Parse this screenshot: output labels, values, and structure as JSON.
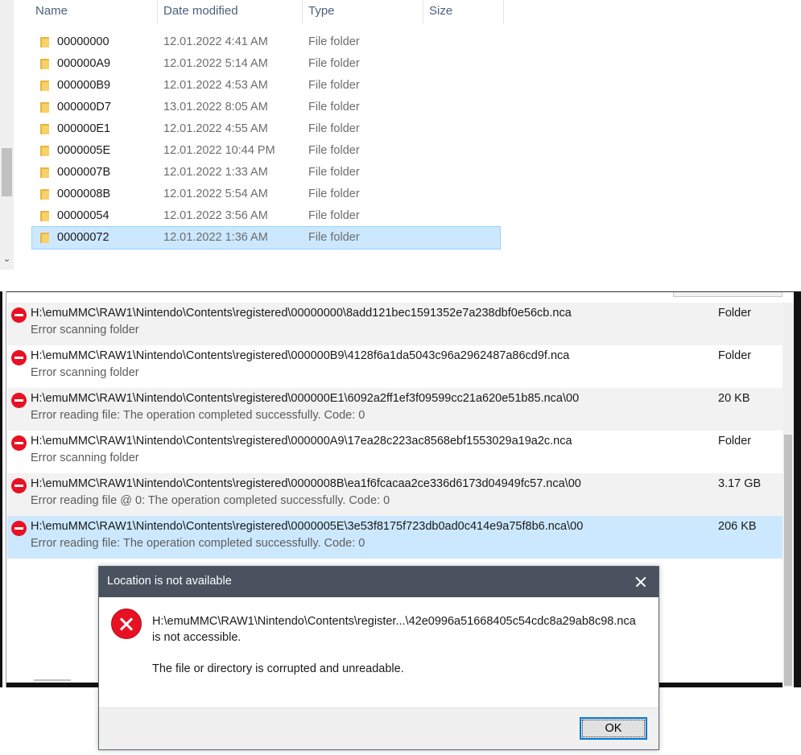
{
  "explorer": {
    "columns": {
      "name": "Name",
      "date": "Date modified",
      "type": "Type",
      "size": "Size"
    },
    "rows": [
      {
        "name": "00000000",
        "date": "12.01.2022 4:41 AM",
        "type": "File folder"
      },
      {
        "name": "000000A9",
        "date": "12.01.2022 5:14 AM",
        "type": "File folder"
      },
      {
        "name": "000000B9",
        "date": "12.01.2022 4:53 AM",
        "type": "File folder"
      },
      {
        "name": "000000D7",
        "date": "13.01.2022 8:05 AM",
        "type": "File folder"
      },
      {
        "name": "000000E1",
        "date": "12.01.2022 4:55 AM",
        "type": "File folder"
      },
      {
        "name": "0000005E",
        "date": "12.01.2022 10:44 PM",
        "type": "File folder"
      },
      {
        "name": "0000007B",
        "date": "12.01.2022 1:33 AM",
        "type": "File folder"
      },
      {
        "name": "0000008B",
        "date": "12.01.2022 5:54 AM",
        "type": "File folder"
      },
      {
        "name": "00000054",
        "date": "12.01.2022 3:56 AM",
        "type": "File folder"
      },
      {
        "name": "00000072",
        "date": "12.01.2022 1:36 AM",
        "type": "File folder"
      }
    ],
    "selected_row": "00000072"
  },
  "errors": {
    "items": [
      {
        "path": "H:\\emuMMC\\RAW1\\Nintendo\\Contents\\registered\\00000000\\8add121bec1591352e7a238dbf0e56cb.nca",
        "message": "Error scanning folder",
        "size": "Folder"
      },
      {
        "path": "H:\\emuMMC\\RAW1\\Nintendo\\Contents\\registered\\000000B9\\4128f6a1da5043c96a2962487a86cd9f.nca",
        "message": "Error scanning folder",
        "size": "Folder"
      },
      {
        "path": "H:\\emuMMC\\RAW1\\Nintendo\\Contents\\registered\\000000E1\\6092a2ff1ef3f09599cc21a620e51b85.nca\\00",
        "message": "Error reading file: The operation completed successfully. Code: 0",
        "size": "20 KB"
      },
      {
        "path": "H:\\emuMMC\\RAW1\\Nintendo\\Contents\\registered\\000000A9\\17ea28c223ac8568ebf1553029a19a2c.nca",
        "message": "Error scanning folder",
        "size": "Folder"
      },
      {
        "path": "H:\\emuMMC\\RAW1\\Nintendo\\Contents\\registered\\0000008B\\ea1f6fcacaa2ce336d6173d04949fc57.nca\\00",
        "message": "Error reading file @ 0: The operation completed successfully. Code: 0",
        "size": "3.17 GB"
      },
      {
        "path": "H:\\emuMMC\\RAW1\\Nintendo\\Contents\\registered\\0000005E\\3e53f8175f723db0ad0c414e9a75f8b6.nca\\00",
        "message": "Error reading file: The operation completed successfully. Code: 0",
        "size": "206 KB"
      }
    ],
    "selected_index": 5
  },
  "dialog": {
    "title": "Location is not available",
    "line1": "H:\\emuMMC\\RAW1\\Nintendo\\Contents\\register...\\42e0996a51668405c54cdc8a29ab8c98.nca",
    "line2": "is not accessible.",
    "line3": "The file or directory is corrupted and unreadable.",
    "ok_label": "OK"
  },
  "colors": {
    "selection": "#cce8ff",
    "error_red": "#e81123",
    "dialog_titlebar": "#4a5260",
    "folder_yellow": "#f7d26a"
  },
  "icons": {
    "folder": "folder-icon",
    "stop": "stop-icon",
    "error": "error-icon",
    "close": "close-icon"
  }
}
